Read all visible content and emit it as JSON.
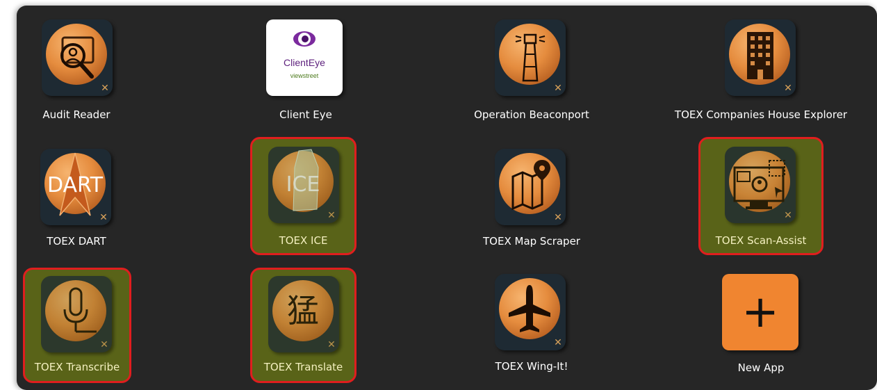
{
  "apps": [
    {
      "label": "Audit Reader",
      "icon": "audit-reader-icon",
      "selected": false
    },
    {
      "label": "Client Eye",
      "icon": "client-eye-icon",
      "selected": false,
      "brand_main": "Client",
      "brand_suffix": "Eye",
      "brand_sub": "viewstreet"
    },
    {
      "label": "Operation Beaconport",
      "icon": "lighthouse-icon",
      "selected": false
    },
    {
      "label": "TOEX Companies House Explorer",
      "icon": "building-icon",
      "selected": false
    },
    {
      "label": "TOEX DART",
      "icon": "dart-icon",
      "selected": false,
      "icon_text": "DART"
    },
    {
      "label": "TOEX ICE",
      "icon": "ice-icon",
      "selected": true,
      "icon_text": "ICE"
    },
    {
      "label": "TOEX Map Scraper",
      "icon": "map-pin-icon",
      "selected": false
    },
    {
      "label": "TOEX Scan-Assist",
      "icon": "scan-assist-icon",
      "selected": true
    },
    {
      "label": "TOEX Transcribe",
      "icon": "microphone-icon",
      "selected": true
    },
    {
      "label": "TOEX Translate",
      "icon": "translate-icon",
      "selected": true,
      "icon_text": "猛"
    },
    {
      "label": "TOEX Wing-It!",
      "icon": "airplane-icon",
      "selected": false
    },
    {
      "label": "New App",
      "icon": "plus-icon",
      "selected": false
    }
  ],
  "colors": {
    "background": "#262626",
    "accent_orange": "#f08530",
    "selection_border": "#e01e1e",
    "selection_fill": "#84960c"
  }
}
